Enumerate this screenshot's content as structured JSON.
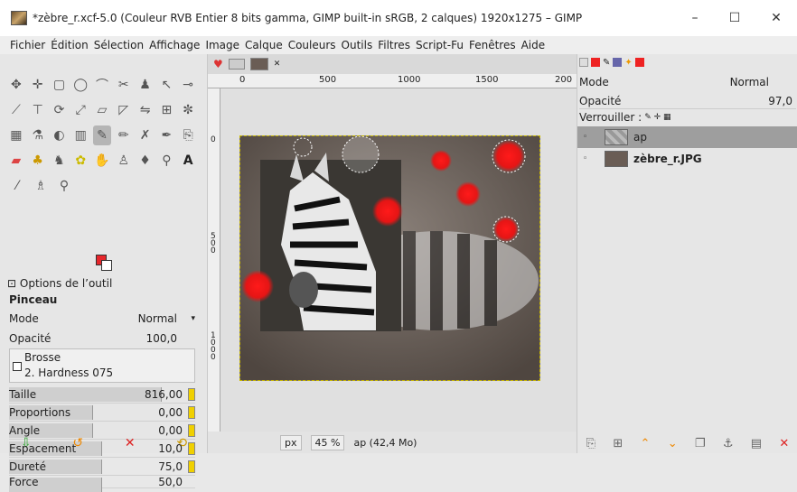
{
  "window": {
    "title": "*zèbre_r.xcf-5.0 (Couleur RVB Entier 8 bits gamma, GIMP built-in sRGB, 2 calques) 1920x1275 – GIMP",
    "minimize": "–",
    "maximize": "☐",
    "close": "✕"
  },
  "menu": [
    "Fichier",
    "Édition",
    "Sélection",
    "Affichage",
    "Image",
    "Calque",
    "Couleurs",
    "Outils",
    "Filtres",
    "Script-Fu",
    "Fenêtres",
    "Aide"
  ],
  "tool_options": {
    "tab_label": "Options de l’outil",
    "tool_name": "Pinceau",
    "mode_label": "Mode",
    "mode_value": "Normal",
    "opacity_label": "Opacité",
    "opacity_value": "100,0",
    "brush_label": "Brosse",
    "brush_value": "2. Hardness 075",
    "sliders": [
      {
        "label": "Taille",
        "value": "816,00",
        "fraction": 0.82
      },
      {
        "label": "Proportions",
        "value": "0,00",
        "fraction": 0.45
      },
      {
        "label": "Angle",
        "value": "0,00",
        "fraction": 0.45
      },
      {
        "label": "Espacement",
        "value": "10,0",
        "fraction": 0.5
      },
      {
        "label": "Dureté",
        "value": "75,0",
        "fraction": 0.5
      },
      {
        "label": "Force",
        "value": "50,0",
        "fraction": 0.5
      }
    ]
  },
  "ruler": {
    "h_ticks": [
      "0",
      "500",
      "1000",
      "1500",
      "200"
    ],
    "v_ticks": [
      "0",
      "5 0 0",
      "1 0 0 0"
    ]
  },
  "status": {
    "unit": "px",
    "zoom": "45 %",
    "layer_info": "ap (42,4 Mo)"
  },
  "layers_panel": {
    "mode_label": "Mode",
    "mode_value": "Normal",
    "opacity_label": "Opacité",
    "opacity_value": "97,0",
    "lock_label": "Verrouiller :",
    "layers": [
      {
        "name": "ap",
        "selected": true
      },
      {
        "name": "zèbre_r.JPG",
        "selected": false
      }
    ]
  },
  "colors": {
    "foreground": "#e6262b",
    "background": "#ffffff",
    "accent": "#f0d000"
  }
}
